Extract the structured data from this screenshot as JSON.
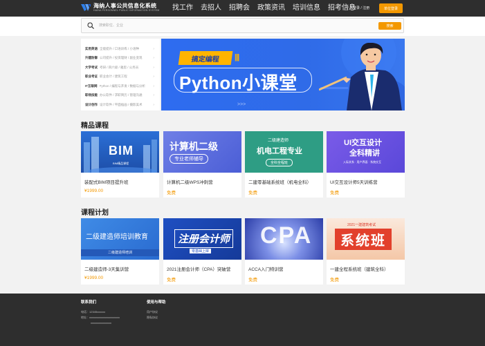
{
  "header": {
    "logo_title": "海纳人事公共信息化系统",
    "logo_subtitle": "HAINA PERSONNEL PUBLIC INFORMATION SYSTEM",
    "nav": [
      "找工作",
      "去招人",
      "招聘会",
      "政策资讯",
      "培训信息",
      "招考信息"
    ],
    "user_links": "个人登录 / 注册",
    "login_button": "单位登录",
    "colors": {
      "bg": "#2e2e2e",
      "accent": "#f39800"
    }
  },
  "search": {
    "placeholder": "搜索职位、企业",
    "button": "搜索"
  },
  "categories": [
    {
      "name": "实用英语",
      "subs": "全能提升 / 口语训练 / 小语种"
    },
    {
      "name": "升建防御",
      "subs": "公司提升 / 投资理财 / 副业变现"
    },
    {
      "name": "大学考试",
      "subs": "考研 / 四六级 / 雅思 / 公务员"
    },
    {
      "name": "职业考证",
      "subs": "职业会计 / 建筑工程"
    },
    {
      "name": "IT互联网",
      "subs": "Python / 编程与开发 / 数据与分析"
    },
    {
      "name": "职场技能",
      "subs": "办公软件 / 求职简历 / 管理沟通"
    },
    {
      "name": "设计创作",
      "subs": "设计软件 / 平面插画 / 摄影美术"
    }
  ],
  "banner": {
    "tag": "搞定编程",
    "bars": "|||",
    "title": "Python小课堂",
    "arrows": ">>>"
  },
  "sections": {
    "featured_title": "精品课程",
    "plan_title": "课程计划"
  },
  "featured": [
    {
      "title": "装配式BIM项目提升班",
      "price": "¥1999.00",
      "img_text": "BIM",
      "img_sub": "BIM精品课程"
    },
    {
      "title": "计算机二级WPS冲刺营",
      "price": "免费",
      "img_text": "计算机二级",
      "img_sub": "专业老师辅导"
    },
    {
      "title": "二建零基础系统班（机电全科）",
      "price": "免费",
      "img_text": "机电工程专业",
      "img_top": "二级建造师",
      "img_sub": "全科全程班"
    },
    {
      "title": "UI交互设计师5天训练营",
      "price": "免费",
      "img_text": "UI交互设计",
      "img_line2": "全科精讲",
      "img_sub": "入际关系 · 用户界面 · 系统交互"
    }
  ],
  "plan": [
    {
      "title": "二级建造师-3天集训营",
      "price": "¥1999.00",
      "img_text": "二级建造师培训教育",
      "img_sub": "二级建造师培训"
    },
    {
      "title": "2021注册会计师（CPA）突破营",
      "price": "免费",
      "img_text": "注册会计师",
      "img_sub": "零基础上岸"
    },
    {
      "title": "ACCA入门特训营",
      "price": "免费",
      "img_text": "CPA"
    },
    {
      "title": "一建全程系统班（建筑全科）",
      "price": "免费",
      "img_text": "系统班",
      "img_top": "2021一建建筑考试"
    }
  ],
  "footer": {
    "contact_title": "联系我们",
    "contact_lines": [
      "电话：12345xxxxxx",
      "地址：xxxxxxxxxxxxxxxxxxxxxx",
      "xxxxxxxxxxxxxxx"
    ],
    "help_title": "使用与帮助",
    "help_links": [
      "用户协议",
      "隐私协议"
    ]
  }
}
